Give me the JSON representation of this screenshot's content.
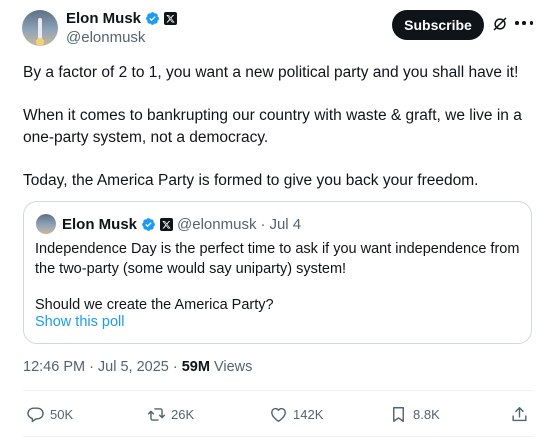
{
  "author": {
    "display_name": "Elon Musk",
    "handle": "@elonmusk"
  },
  "header": {
    "subscribe_label": "Subscribe"
  },
  "tweet": {
    "paragraphs": [
      "By a factor of 2 to 1, you want a new political party and you shall have it!",
      "When it comes to bankrupting our country with waste & graft, we live in a one-party system, not a democracy.",
      "Today, the America Party is formed to give you back your freedom."
    ],
    "time": "12:46 PM",
    "separator": "·",
    "date": "Jul 5, 2025",
    "views_count": "59M",
    "views_label": "Views"
  },
  "quote": {
    "display_name": "Elon Musk",
    "handle": "@elonmusk",
    "separator": "·",
    "date": "Jul 4",
    "paragraphs": [
      "Independence Day is the perfect time to ask if you want independence from the two-party (some would say uniparty) system!",
      "Should we create the America Party?"
    ],
    "poll_link": "Show this poll"
  },
  "actions": {
    "replies": "50K",
    "reposts": "26K",
    "likes": "142K",
    "bookmarks": "8.8K"
  },
  "colors": {
    "text": "#0f1419",
    "secondary": "#536471",
    "link": "#1d9bf0",
    "verified": "#1d9bf0",
    "border": "#cfd9de"
  },
  "icons": [
    "verified-badge-icon",
    "x-logo-icon",
    "grok-icon",
    "more-icon",
    "reply-icon",
    "repost-icon",
    "like-icon",
    "bookmark-icon",
    "share-icon"
  ]
}
